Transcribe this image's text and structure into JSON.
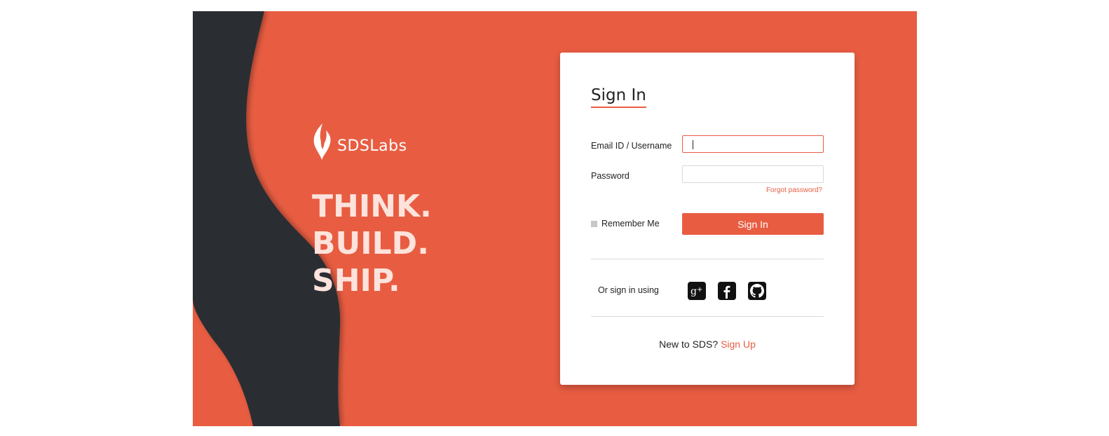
{
  "brand": {
    "logo_text": "SDSLabs",
    "slogan": [
      "THINK.",
      "BUILD.",
      "SHIP."
    ],
    "accent_color": "#e85d42",
    "dark_color": "#2b2d33"
  },
  "form": {
    "title": "Sign In",
    "email_label": "Email ID / Username",
    "email_value": "",
    "password_label": "Password",
    "password_value": "",
    "forgot_label": "Forgot password?",
    "remember_label": "Remember Me",
    "submit_label": "Sign In"
  },
  "social": {
    "label": "Or sign in using",
    "providers": [
      {
        "name": "google-plus",
        "icon": "google-plus-icon"
      },
      {
        "name": "facebook",
        "icon": "facebook-icon"
      },
      {
        "name": "github",
        "icon": "github-icon"
      }
    ]
  },
  "signup": {
    "prompt": "New to SDS?",
    "link_label": "Sign Up"
  }
}
